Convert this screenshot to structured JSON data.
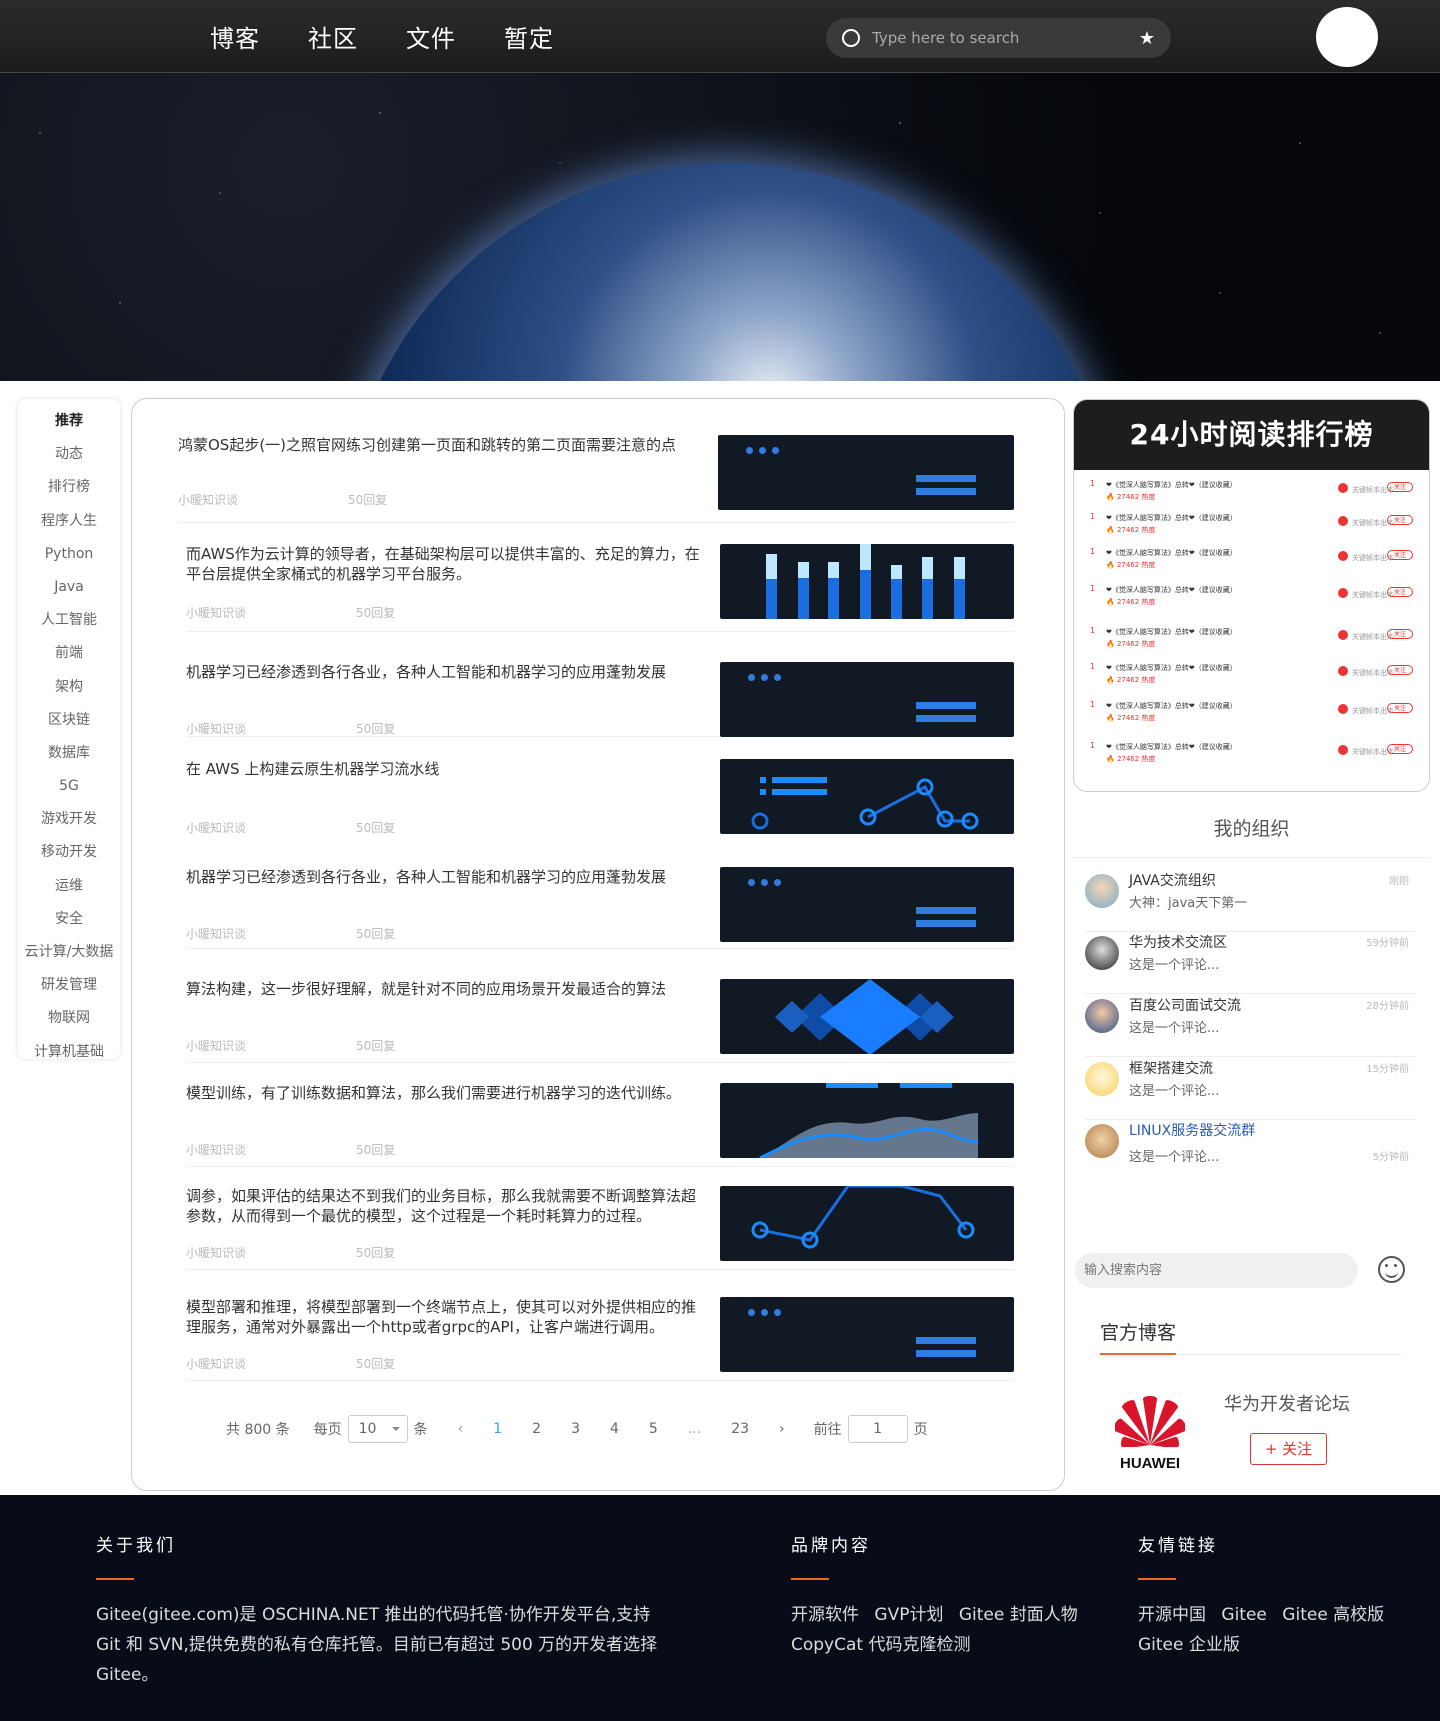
{
  "nav": {
    "items": [
      "博客",
      "社区",
      "文件",
      "暂定"
    ]
  },
  "search": {
    "placeholder": "Type here to search",
    "star": "★"
  },
  "categories": [
    "推荐",
    "动态",
    "排行榜",
    "程序人生",
    "Python",
    "Java",
    "人工智能",
    "前端",
    "架构",
    "区块链",
    "数据库",
    "5G",
    "游戏开发",
    "移动开发",
    "运维",
    "安全",
    "云计算/大数据",
    "研发管理",
    "物联网",
    "计算机基础"
  ],
  "articles": [
    {
      "title": "鸿蒙OS起步(一)之照官网练习创建第一页面和跳转的第二页面需要注意的点",
      "author": "小暖知识谈",
      "replies": "50回复"
    },
    {
      "title": "而AWS作为云计算的领导者，在基础架构层可以提供丰富的、充足的算力，在平台层提供全家桶式的机器学习平台服务。",
      "author": "小暖知识谈",
      "replies": "50回复"
    },
    {
      "title": "机器学习已经渗透到各行各业，各种人工智能和机器学习的应用蓬勃发展",
      "author": "小暖知识谈",
      "replies": "50回复"
    },
    {
      "title": "在 AWS 上构建云原生机器学习流水线",
      "author": "小暖知识谈",
      "replies": "50回复"
    },
    {
      "title": "机器学习已经渗透到各行各业，各种人工智能和机器学习的应用蓬勃发展",
      "author": "小暖知识谈",
      "replies": "50回复"
    },
    {
      "title": "算法构建，这一步很好理解，就是针对不同的应用场景开发最适合的算法",
      "author": "小暖知识谈",
      "replies": "50回复"
    },
    {
      "title": "模型训练，有了训练数据和算法，那么我们需要进行机器学习的迭代训练。",
      "author": "小暖知识谈",
      "replies": "50回复"
    },
    {
      "title": "调参，如果评估的结果达不到我们的业务目标，那么我就需要不断调整算法超参数，从而得到一个最优的模型，这个过程是一个耗时耗算力的过程。",
      "author": "小暖知识谈",
      "replies": "50回复"
    },
    {
      "title": "模型部署和推理，将模型部署到一个终端节点上，使其可以对外提供相应的推理服务，通常对外暴露出一个http或者grpc的API，让客户端进行调用。",
      "author": "小暖知识谈",
      "replies": "50回复"
    }
  ],
  "pager": {
    "total": "共 800 条",
    "per_page_label": "每页",
    "per_page_value": "10",
    "unit": "条",
    "pages": [
      "1",
      "2",
      "3",
      "4",
      "5",
      "...",
      "23"
    ],
    "goto_label": "前往",
    "goto_value": "1",
    "page_unit": "页",
    "prev": "‹",
    "next": "›"
  },
  "ranking": {
    "title": "24小时阅读排行榜",
    "rows": [
      {
        "num": "1",
        "title": "❤《觉深人脑写算法》总转❤（建议收藏）",
        "hot": "🔥 27462 热度",
        "source": "关键帧本出本",
        "tag": "关注"
      },
      {
        "num": "1",
        "title": "❤《觉深人脑写算法》总转❤（建议收藏）",
        "hot": "🔥 27462 热度",
        "source": "关键帧本出本",
        "tag": "关注"
      },
      {
        "num": "1",
        "title": "❤《觉深人脑写算法》总转❤（建议收藏）",
        "hot": "🔥 27462 热度",
        "source": "关键帧本出本",
        "tag": "关注"
      },
      {
        "num": "1",
        "title": "❤《觉深人脑写算法》总转❤（建议收藏）",
        "hot": "🔥 27462 热度",
        "source": "关键帧本出本",
        "tag": "关注"
      },
      {
        "num": "1",
        "title": "❤《觉深人脑写算法》总转❤（建议收藏）",
        "hot": "🔥 27462 热度",
        "source": "关键帧本出本",
        "tag": "关注"
      },
      {
        "num": "1",
        "title": "❤《觉深人脑写算法》总转❤（建议收藏）",
        "hot": "🔥 27462 热度",
        "source": "关键帧本出本",
        "tag": "关注"
      },
      {
        "num": "1",
        "title": "❤《觉深人脑写算法》总转❤（建议收藏）",
        "hot": "🔥 27462 热度",
        "source": "关键帧本出本",
        "tag": "关注"
      },
      {
        "num": "1",
        "title": "❤《觉深人脑写算法》总转❤（建议收藏）",
        "hot": "🔥 27462 热度",
        "source": "关键帧本出本",
        "tag": "关注"
      }
    ]
  },
  "orgs": {
    "title": "我的组织",
    "items": [
      {
        "name": "JAVA交流组织",
        "msg": "大神：java天下第一",
        "time": "刚刚"
      },
      {
        "name": "华为技术交流区",
        "msg": "这是一个评论...",
        "time": "59分钟前"
      },
      {
        "name": "百度公司面试交流",
        "msg": "这是一个评论...",
        "time": "28分钟前"
      },
      {
        "name": "框架搭建交流",
        "msg": "这是一个评论...",
        "time": "15分钟前"
      },
      {
        "name": "LINUX服务器交流群",
        "msg": "这是一个评论...",
        "time": "5分钟前"
      }
    ]
  },
  "right_search": {
    "placeholder": "输入搜索内容"
  },
  "official": {
    "title": "官方博客",
    "logo_text": "HUAWEI",
    "name": "华为开发者论坛",
    "follow": "+ 关注"
  },
  "footer": {
    "about": {
      "title": "关于我们",
      "text": "Gitee(gitee.com)是 OSCHINA.NET 推出的代码托管·协作开发平台,支持 Git 和 SVN,提供免费的私有仓库托管。目前已有超过 500 万的开发者选择 Gitee。"
    },
    "brand": {
      "title": "品牌内容",
      "links": [
        "开源软件",
        "GVP计划",
        "Gitee 封面人物",
        "CopyCat 代码克隆检测"
      ]
    },
    "friends": {
      "title": "友情链接",
      "links": [
        "开源中国",
        "Gitee",
        "Gitee 高校版",
        "Gitee 企业版"
      ]
    }
  }
}
